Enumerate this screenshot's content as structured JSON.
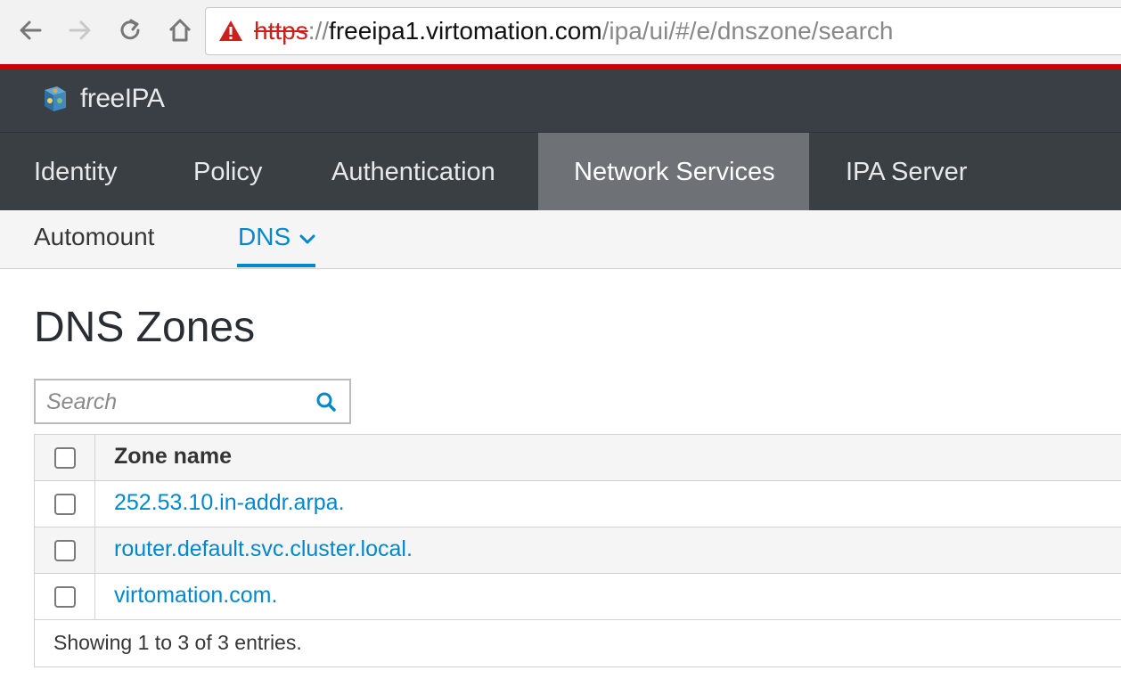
{
  "browser": {
    "url_scheme": "https",
    "url_sep": "://",
    "url_host": "freeipa1.virtomation.com",
    "url_path": "/ipa/ui/#/e/dnszone/search"
  },
  "app": {
    "logo_text": "freeIPA"
  },
  "primary_nav": [
    {
      "label": "Identity"
    },
    {
      "label": "Policy"
    },
    {
      "label": "Authentication"
    },
    {
      "label": "Network Services",
      "active": true
    },
    {
      "label": "IPA Server"
    }
  ],
  "secondary_nav": [
    {
      "label": "Automount"
    },
    {
      "label": "DNS",
      "active": true
    }
  ],
  "page": {
    "title": "DNS Zones",
    "search_placeholder": "Search"
  },
  "table": {
    "header": "Zone name",
    "rows": [
      {
        "name": "252.53.10.in-addr.arpa."
      },
      {
        "name": "router.default.svc.cluster.local."
      },
      {
        "name": "virtomation.com."
      }
    ],
    "footer": "Showing 1 to 3 of 3 entries."
  },
  "colors": {
    "accent": "#0088ce",
    "header_bg": "#393f44",
    "active_tab_bg": "#6e7175",
    "warning": "#c9211e"
  },
  "icons": [
    "back-icon",
    "forward-icon",
    "reload-icon",
    "home-icon",
    "warning-icon",
    "freeipa-logo-icon",
    "chevron-down-icon",
    "search-icon"
  ]
}
